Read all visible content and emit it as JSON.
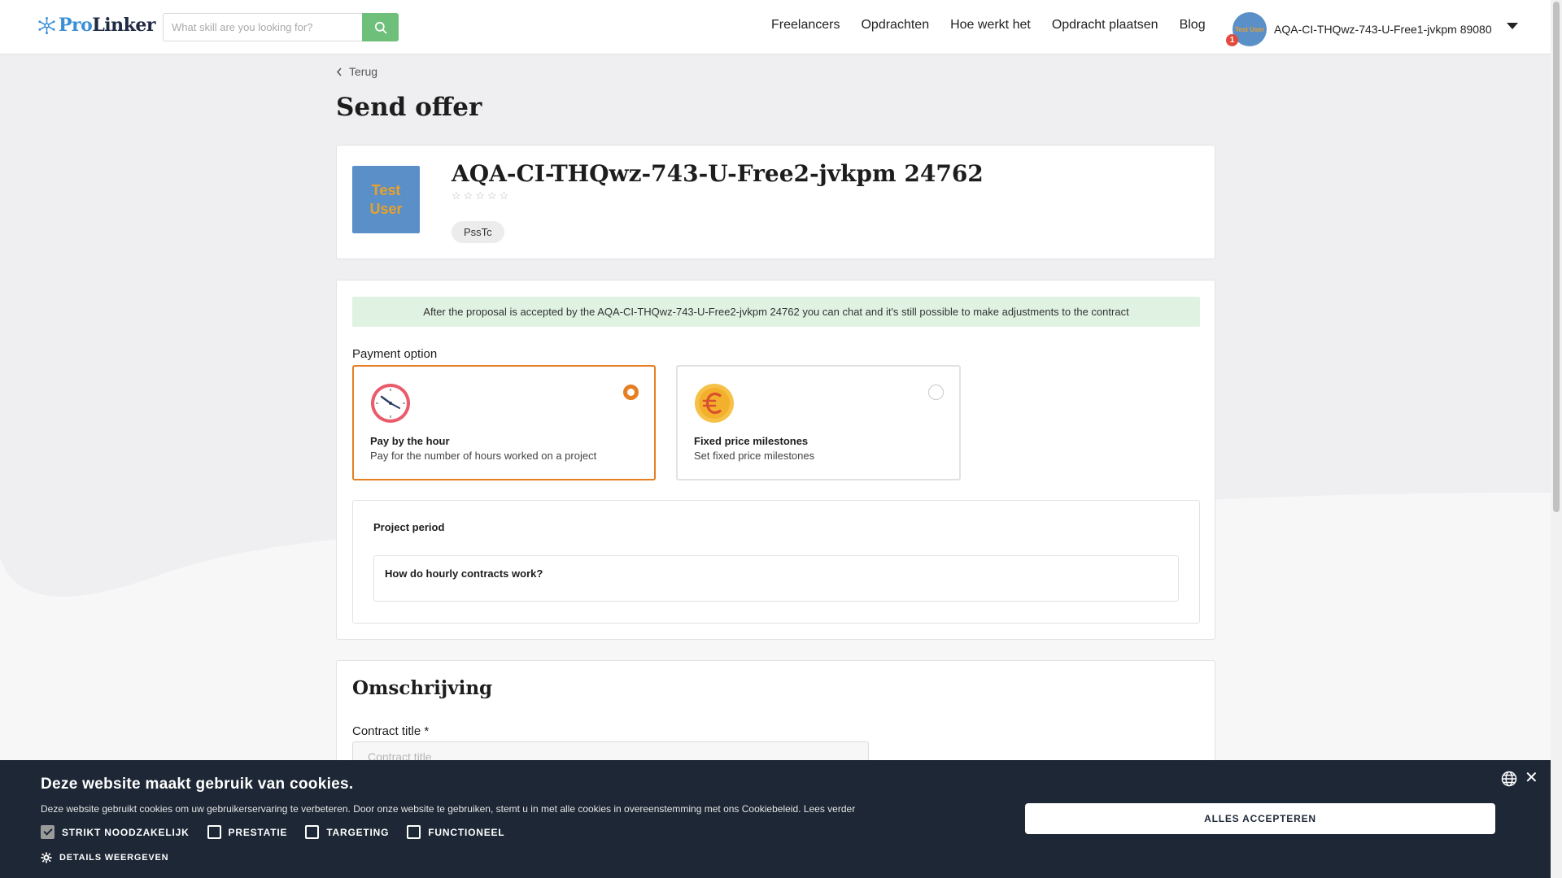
{
  "header": {
    "logo_pro": "Pro",
    "logo_linker": "Linker",
    "search_placeholder": "What skill are you looking for?",
    "nav": [
      "Freelancers",
      "Opdrachten",
      "Hoe werkt het",
      "Opdracht plaatsen",
      "Blog"
    ],
    "user_avatar_text": "Test User",
    "notification_count": "1",
    "user_name": "AQA-CI-THQwz-743-U-Free1-jvkpm 89080"
  },
  "page": {
    "back_label": "Terug",
    "title": "Send offer"
  },
  "freelancer": {
    "avatar_line1": "Test",
    "avatar_line2": "User",
    "name": "AQA-CI-THQwz-743-U-Free2-jvkpm 24762",
    "rating": 0,
    "star_glyph": "☆",
    "tag": "PssTc"
  },
  "payment": {
    "info": "After the proposal is accepted by the AQA-CI-THQwz-743-U-Free2-jvkpm 24762 you can chat and it's still possible to make adjustments to the contract",
    "label": "Payment option",
    "options": [
      {
        "title": "Pay by the hour",
        "desc": "Pay for the number of hours worked on a project",
        "selected": true,
        "icon": "clock-icon"
      },
      {
        "title": "Fixed price milestones",
        "desc": "Set fixed price milestones",
        "selected": false,
        "icon": "euro-coin-icon"
      }
    ],
    "period_title": "Project period",
    "hourly_question": "How do hourly contracts work?"
  },
  "description": {
    "title": "Omschrijving",
    "contract_label": "Contract title *",
    "contract_placeholder": "Contract title"
  },
  "cookie": {
    "title": "Deze website maakt gebruik van cookies.",
    "text": "Deze website gebruikt cookies om uw gebruikerservaring te verbeteren. Door onze website te gebruiken, stemt u in met alle cookies in overeenstemming met ons Cookiebeleid.",
    "read_more": "Lees verder",
    "checkboxes": [
      {
        "label": "STRIKT NOODZAKELIJK",
        "checked": true
      },
      {
        "label": "PRESTATIE",
        "checked": false
      },
      {
        "label": "TARGETING",
        "checked": false
      },
      {
        "label": "FUNCTIONEEL",
        "checked": false
      }
    ],
    "details": "DETAILS WEERGEVEN",
    "accept": "ALLES ACCEPTEREN",
    "close": "✕"
  },
  "colors": {
    "accent": "#e67e22",
    "search_button": "#6dbf7a",
    "cookie_bg": "#1d2735",
    "info_bg": "#e0f2e2"
  }
}
